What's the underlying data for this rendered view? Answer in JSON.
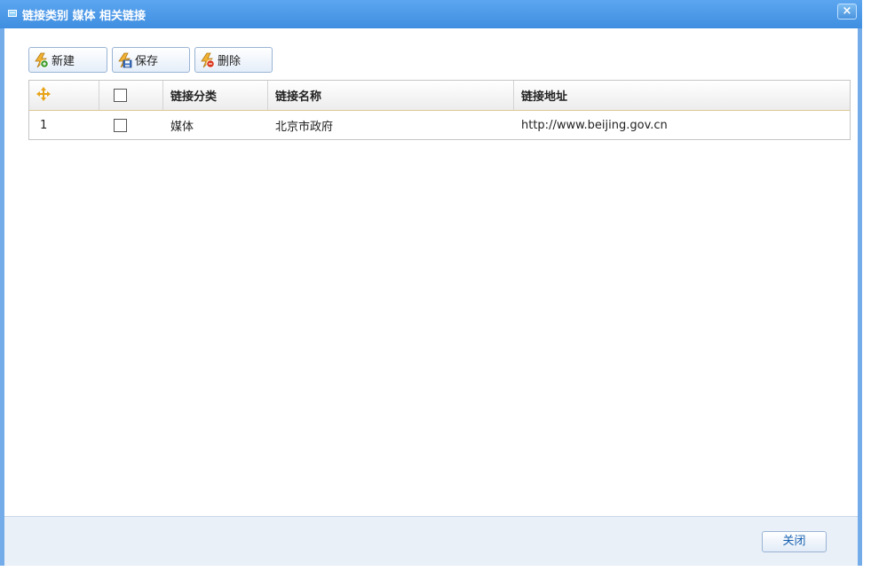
{
  "window": {
    "title": "链接类别 媒体 相关链接",
    "close_glyph": "×"
  },
  "toolbar": {
    "new_label": "新建",
    "save_label": "保存",
    "delete_label": "删除"
  },
  "grid": {
    "columns": {
      "category": "链接分类",
      "name": "链接名称",
      "url": "链接地址"
    },
    "rows": [
      {
        "index": "1",
        "category": "媒体",
        "name": "北京市政府",
        "url": "http://www.beijing.gov.cn"
      }
    ]
  },
  "footer": {
    "close_label": "关闭"
  },
  "colors": {
    "title_bar": "#4a97e6",
    "border": "#74ace9",
    "header_separator": "#e0c896",
    "drag_icon": "#e8a317"
  },
  "icons": {
    "title": "window-icon",
    "new": "lightning-add-icon",
    "save": "save-icon",
    "delete": "lightning-delete-icon",
    "drag": "move-icon",
    "close": "close-icon"
  }
}
